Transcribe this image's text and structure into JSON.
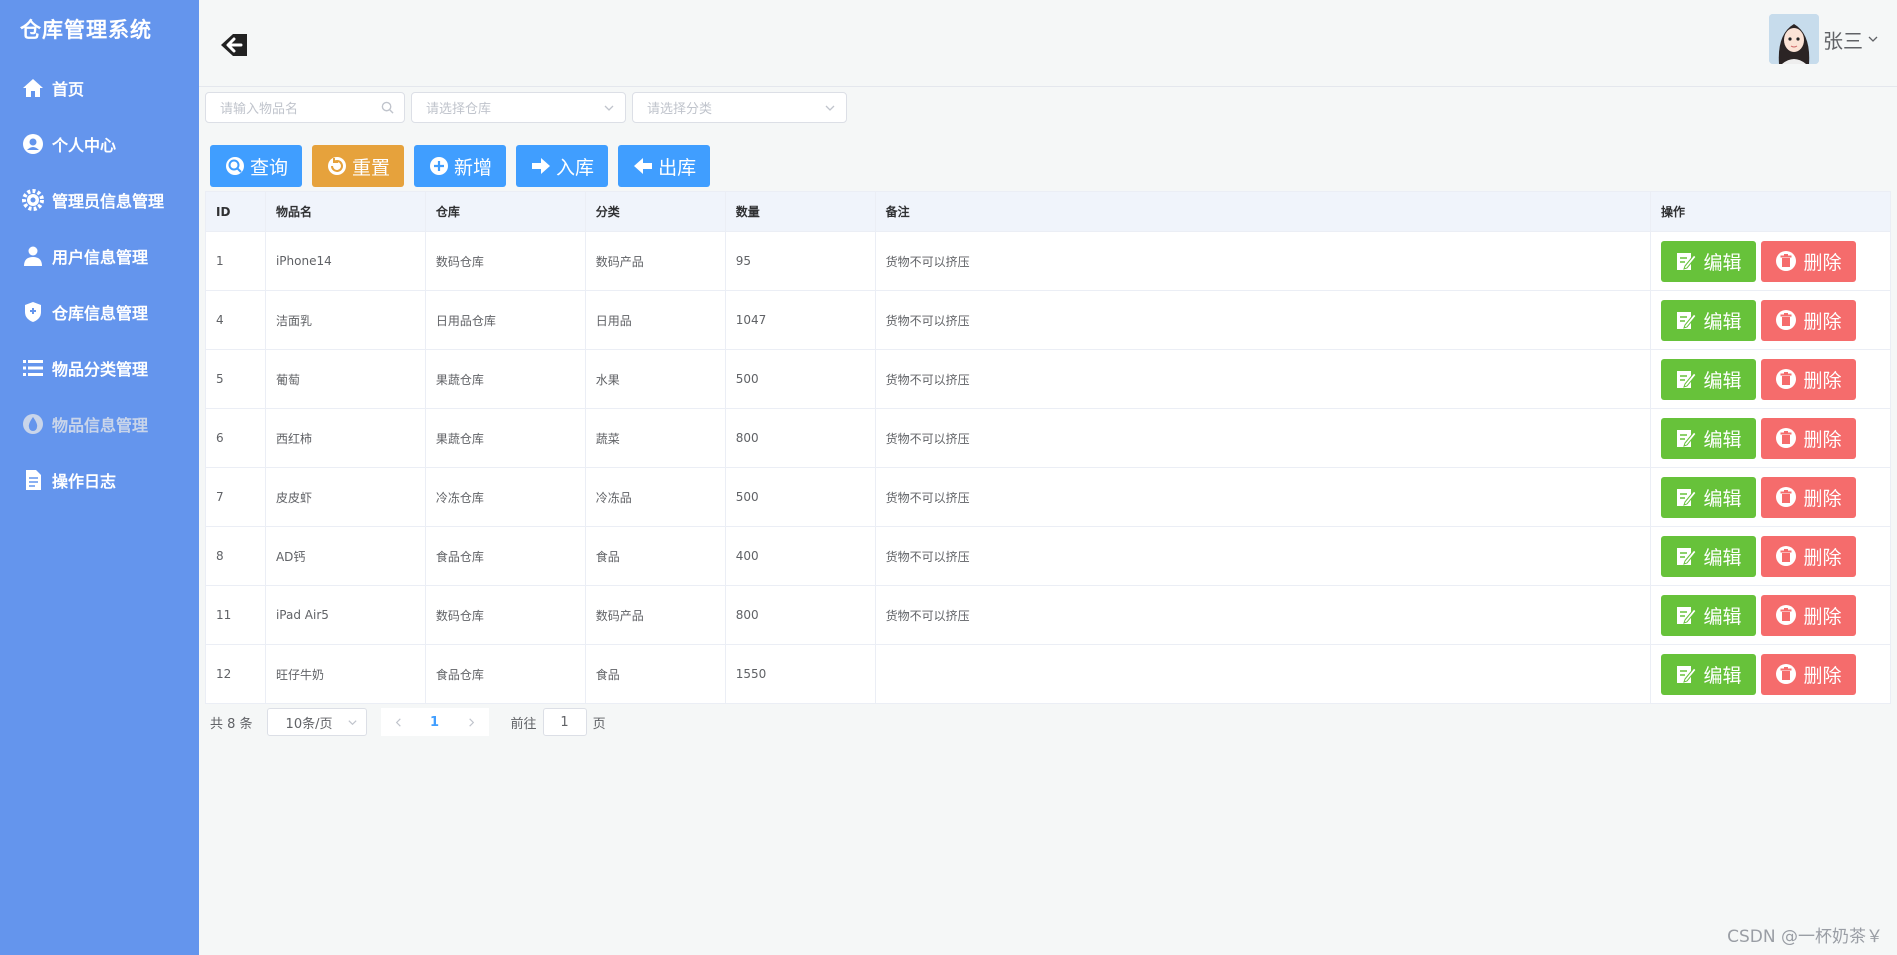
{
  "app": {
    "title": "仓库管理系统"
  },
  "sidebar": {
    "items": [
      {
        "label": "首页",
        "icon": "home-icon"
      },
      {
        "label": "个人中心",
        "icon": "user-circle-icon"
      },
      {
        "label": "管理员信息管理",
        "icon": "gear-icon"
      },
      {
        "label": "用户信息管理",
        "icon": "user-icon"
      },
      {
        "label": "仓库信息管理",
        "icon": "warehouse-icon"
      },
      {
        "label": "物品分类管理",
        "icon": "list-icon"
      },
      {
        "label": "物品信息管理",
        "icon": "drop-icon",
        "active": true
      },
      {
        "label": "操作日志",
        "icon": "document-icon"
      }
    ]
  },
  "header": {
    "user_name": "张三"
  },
  "filters": {
    "name_placeholder": "请输入物品名",
    "warehouse_placeholder": "请选择仓库",
    "category_placeholder": "请选择分类"
  },
  "toolbar": {
    "query": "查询",
    "reset": "重置",
    "add": "新增",
    "inbound": "入库",
    "outbound": "出库"
  },
  "table": {
    "columns": [
      "ID",
      "物品名",
      "仓库",
      "分类",
      "数量",
      "备注",
      "操作"
    ],
    "rows": [
      {
        "id": "1",
        "name": "iPhone14",
        "warehouse": "数码仓库",
        "category": "数码产品",
        "qty": "95",
        "note": "货物不可以挤压"
      },
      {
        "id": "4",
        "name": "洁面乳",
        "warehouse": "日用品仓库",
        "category": "日用品",
        "qty": "1047",
        "note": "货物不可以挤压"
      },
      {
        "id": "5",
        "name": "葡萄",
        "warehouse": "果蔬仓库",
        "category": "水果",
        "qty": "500",
        "note": "货物不可以挤压"
      },
      {
        "id": "6",
        "name": "西红柿",
        "warehouse": "果蔬仓库",
        "category": "蔬菜",
        "qty": "800",
        "note": "货物不可以挤压"
      },
      {
        "id": "7",
        "name": "皮皮虾",
        "warehouse": "冷冻仓库",
        "category": "冷冻品",
        "qty": "500",
        "note": "货物不可以挤压"
      },
      {
        "id": "8",
        "name": "AD钙",
        "warehouse": "食品仓库",
        "category": "食品",
        "qty": "400",
        "note": "货物不可以挤压"
      },
      {
        "id": "11",
        "name": "iPad Air5",
        "warehouse": "数码仓库",
        "category": "数码产品",
        "qty": "800",
        "note": "货物不可以挤压"
      },
      {
        "id": "12",
        "name": "旺仔牛奶",
        "warehouse": "食品仓库",
        "category": "食品",
        "qty": "1550",
        "note": ""
      }
    ],
    "edit_label": "编辑",
    "delete_label": "删除"
  },
  "pagination": {
    "total": "共 8 条",
    "page_size": "10条/页",
    "current_page": "1",
    "goto_prefix": "前往",
    "goto_value": "1",
    "goto_suffix": "页"
  },
  "watermark": "CSDN @一杯奶茶￥",
  "colors": {
    "sidebar": "#6495ed",
    "primary": "#409eff",
    "warning": "#e6a23c",
    "success": "#67c23a",
    "danger": "#f56c6c"
  }
}
